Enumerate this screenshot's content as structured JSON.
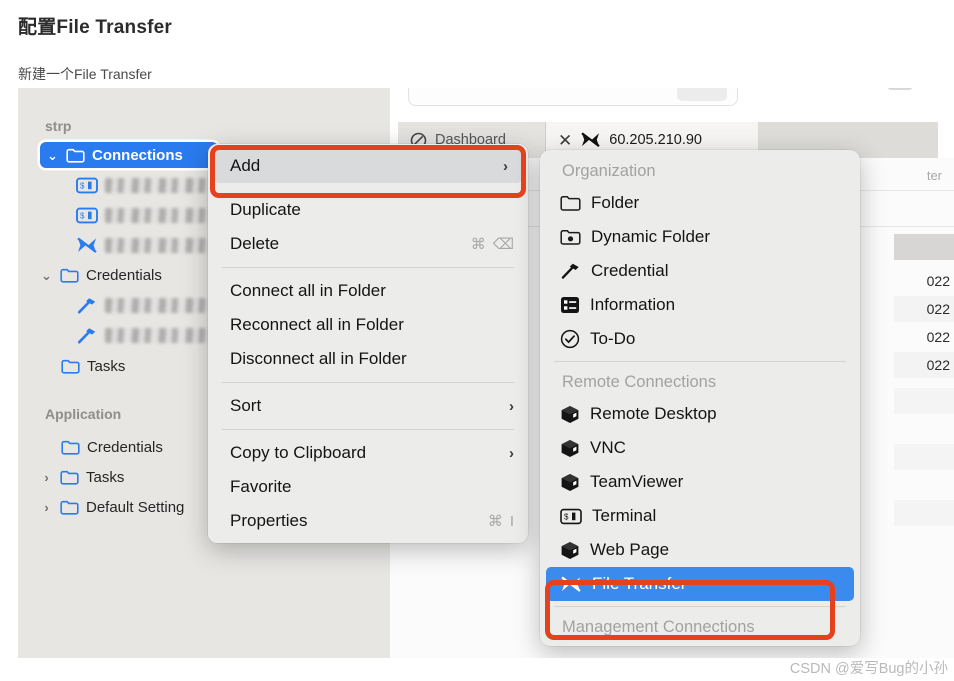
{
  "article": {
    "title": "配置File Transfer",
    "subtitle": "新建一个File Transfer"
  },
  "colors": {
    "annotation_red": "#e5411d",
    "selection_blue": "#3b8aee",
    "tree_selection_blue": "#2a7bf0",
    "sidebar_bg": "#e7e6e3",
    "menu_bg": "#ececeb"
  },
  "sidebar": {
    "group_label": "strp",
    "application_label": "Application",
    "items": [
      {
        "label": "Connections",
        "icon": "folder-icon",
        "twisty": "⌄",
        "selected": true
      },
      {
        "label": "",
        "icon": "terminal-icon",
        "redacted": true
      },
      {
        "label": "",
        "icon": "terminal-icon",
        "redacted": true
      },
      {
        "label": "",
        "icon": "file-transfer-icon",
        "redacted": true
      },
      {
        "label": "Credentials",
        "icon": "folder-icon",
        "twisty": "⌄"
      },
      {
        "label": "",
        "icon": "credential-key-icon",
        "redacted": true
      },
      {
        "label": "",
        "icon": "credential-key-icon",
        "redacted": true
      },
      {
        "label": "Tasks",
        "icon": "folder-icon"
      }
    ],
    "application_items": [
      {
        "label": "Credentials",
        "icon": "folder-icon"
      },
      {
        "label": "Tasks",
        "icon": "folder-icon",
        "twisty": "›"
      },
      {
        "label": "Default Setting",
        "icon": "folder-icon",
        "twisty": "›"
      }
    ]
  },
  "tabs": {
    "dashboard": "Dashboard",
    "active": "60.205.210.90"
  },
  "table": {
    "filter_label": "ter",
    "cells": [
      "022",
      "022",
      "022",
      "022"
    ]
  },
  "context_menu": {
    "items": [
      {
        "label": "Add",
        "submenu": true,
        "highlighted": true,
        "annotated": true
      },
      {
        "separator_after": false,
        "label": "Duplicate"
      },
      {
        "label": "Delete",
        "shortcut_cmd": "⌘",
        "shortcut_key": "⌫"
      },
      {
        "label": "Connect all in Folder"
      },
      {
        "label": "Reconnect all in Folder"
      },
      {
        "label": "Disconnect all in Folder"
      },
      {
        "label": "Sort",
        "submenu": true
      },
      {
        "label": "Copy to Clipboard",
        "submenu": true
      },
      {
        "label": "Favorite"
      },
      {
        "label": "Properties",
        "shortcut_cmd": "⌘",
        "shortcut_key": "I"
      }
    ],
    "arrow_glyph": "›"
  },
  "submenu": {
    "section_organization": "Organization",
    "organization_items": [
      {
        "label": "Folder",
        "icon": "folder-outline-icon"
      },
      {
        "label": "Dynamic Folder",
        "icon": "dynamic-folder-icon"
      },
      {
        "label": "Credential",
        "icon": "credential-key-icon"
      },
      {
        "label": "Information",
        "icon": "information-list-icon"
      },
      {
        "label": "To-Do",
        "icon": "todo-check-icon"
      }
    ],
    "section_remote": "Remote Connections",
    "remote_items": [
      {
        "label": "Remote Desktop",
        "icon": "cube-icon"
      },
      {
        "label": "VNC",
        "icon": "cube-icon"
      },
      {
        "label": "TeamViewer",
        "icon": "cube-icon"
      },
      {
        "label": "Terminal",
        "icon": "terminal-icon"
      },
      {
        "label": "Web Page",
        "icon": "cube-icon"
      },
      {
        "label": "File Transfer",
        "icon": "file-transfer-icon",
        "selected": true,
        "annotated": true
      }
    ],
    "section_management": "Management Connections"
  },
  "watermark": "CSDN @爱写Bug的小孙"
}
